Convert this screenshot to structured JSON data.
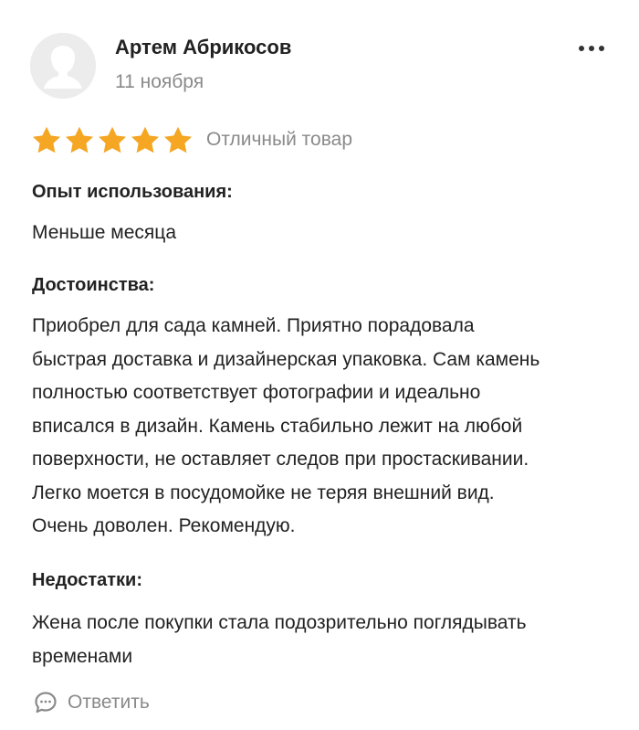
{
  "review": {
    "author": {
      "name": "Артем Абрикосов",
      "date": "11 ноября"
    },
    "rating": {
      "stars": 5,
      "max": 5,
      "label": "Отличный товар",
      "star_color": "#f5a623"
    },
    "experience": {
      "heading": "Опыт использования:",
      "text": "Меньше месяца"
    },
    "pros": {
      "heading": "Достоинства:",
      "lines": [
        "Приобрел для сада камней. Приятно порадовала",
        "быстрая доставка и дизайнерская упаковка. Сам камень",
        "полностью соответствует фотографии и идеально",
        "вписался в дизайн. Камень стабильно лежит на любой",
        "поверхности, не оставляет следов при простаскивании.",
        "Легко моется в посудомойке не теряя внешний вид.",
        "Очень доволен. Рекомендую."
      ]
    },
    "cons": {
      "heading": "Недостатки:",
      "lines": [
        "Жена после покупки стала подозрительно поглядывать",
        "временами"
      ]
    },
    "actions": {
      "reply_label": "Ответить",
      "reply_icon": "comment-icon",
      "more_icon": "more-dots-icon"
    }
  }
}
